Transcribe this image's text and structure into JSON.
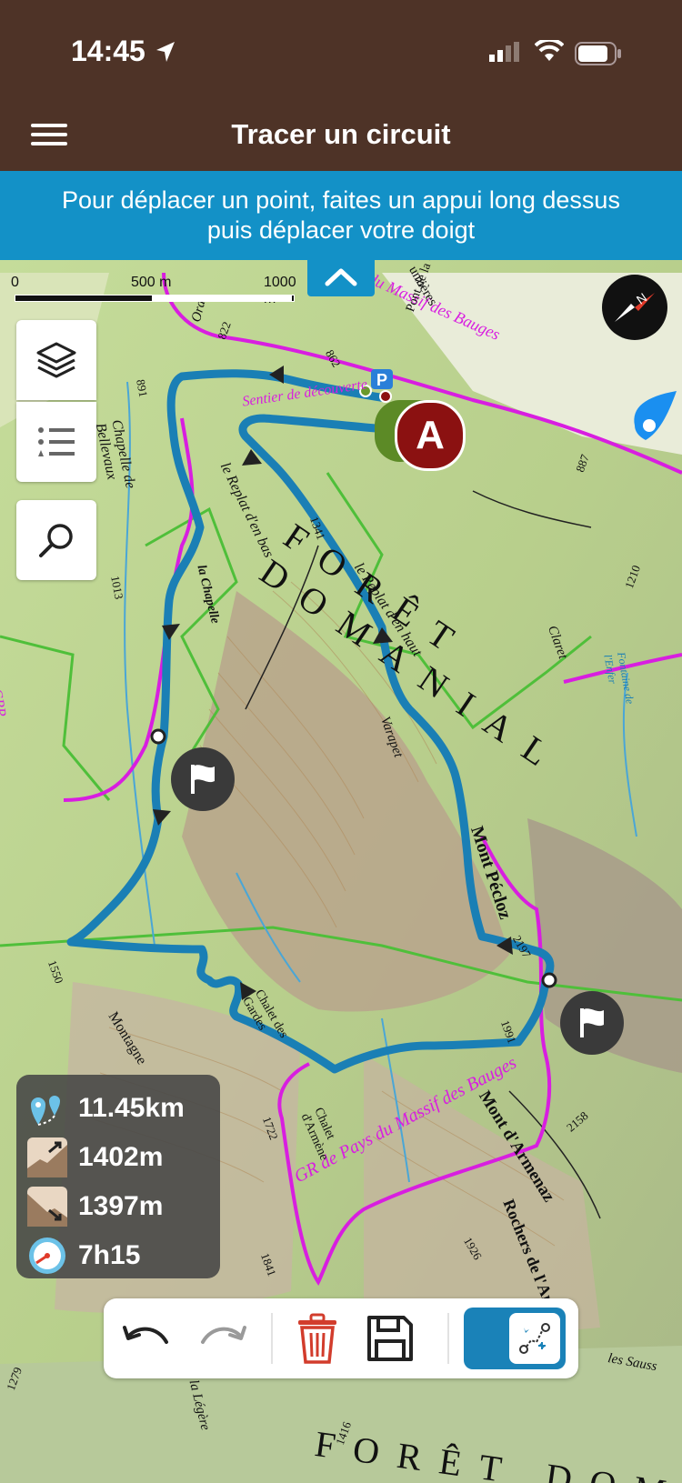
{
  "status_bar": {
    "time": "14:45"
  },
  "header": {
    "title": "Tracer un circuit"
  },
  "banner": {
    "line1": "Pour déplacer un point, faites un appui long dessus",
    "line2": "puis déplacer votre doigt"
  },
  "scale": {
    "zero": "0",
    "mid": "500 m",
    "end": "1000 m"
  },
  "map_labels": {
    "foret_domaniale": "FORÊT DOMANIAL",
    "sentier": "Sentier de découverte",
    "massif_bauges_top": "du Massif des Bauges",
    "gr_pays": "GR de Pays du Massif des Bauges",
    "mont_pecloz": "Mont Pécloz",
    "mont_armenaz": "Mont d'Armenaz",
    "rochers_arpette": "Rochers de l'Arpette",
    "replat_bas": "le Replat d'en bas",
    "replat_haut": "le Replat d'en haut",
    "chapelle": "la Chapelle",
    "chapelle_bellevaux": "Chapelle de Bellevaux",
    "varapet": "Varapet",
    "claret": "Claret",
    "chalet_gardes": "Chalet des Gardes",
    "chalet_armene": "Chalet d'Armène",
    "pont_cariat": "Pont de la Cariat",
    "foret_bottom": "FORÊT DOM",
    "montagne": "Montagne",
    "la_legere": "la Légère",
    "les_sauss": "les Sauss",
    "fontaine": "Fontaine de l'Enfer",
    "umieres": "umières",
    "orat": "Orat",
    "gr_left": "GRP",
    "alt_822": "822",
    "alt_862": "862",
    "alt_887": "887",
    "alt_891": "891",
    "alt_1013": "1013",
    "alt_1210": "1210",
    "alt_1341": "1341",
    "alt_1550": "1550",
    "alt_1722": "1722",
    "alt_1841": "1841",
    "alt_1926": "1926",
    "alt_1991": "1991",
    "alt_2158": "2158",
    "alt_2197": "2197",
    "alt_1279": "1279",
    "alt_1416": "1416",
    "start_label": "A"
  },
  "stats": {
    "distance": "11.45km",
    "ascent": "1402m",
    "descent": "1397m",
    "duration": "7h15"
  },
  "icons": {
    "layers": "layers-icon",
    "list": "list-icon",
    "search": "search-icon",
    "compass": "compass-icon",
    "undo": "undo-icon",
    "redo": "redo-icon",
    "delete": "trash-icon",
    "save": "save-icon",
    "route_mode": "route-points-icon"
  },
  "colors": {
    "header": "#4e3327",
    "banner": "#1391c7",
    "route": "#1a7fb5",
    "trail_magenta": "#d81ee0",
    "start_marker": "#8b1111",
    "delete_red": "#d23c2c"
  }
}
